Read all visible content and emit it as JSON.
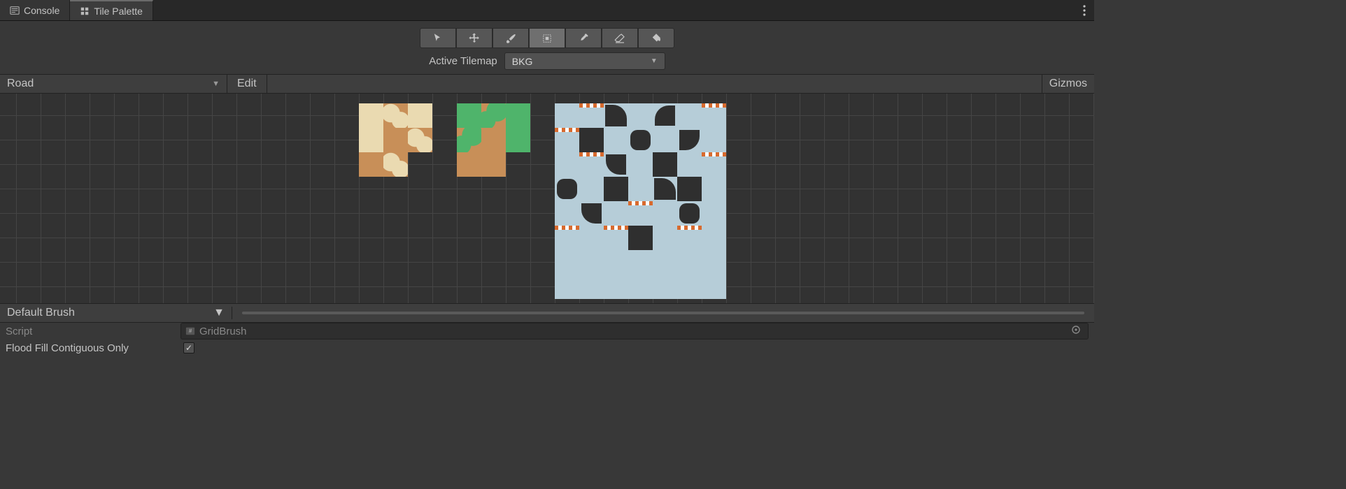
{
  "tabs": {
    "console": "Console",
    "tilepalette": "Tile Palette"
  },
  "tools": {
    "select": "select",
    "move": "move",
    "brush": "brush",
    "box": "box",
    "picker": "picker",
    "erase": "erase",
    "fill": "fill"
  },
  "active_tilemap_label": "Active Tilemap",
  "active_tilemap_value": "BKG",
  "palette": {
    "selected": "Road",
    "edit": "Edit",
    "gizmos": "Gizmos"
  },
  "brush": {
    "selected": "Default Brush"
  },
  "inspector": {
    "script_label": "Script",
    "script_value": "GridBrush",
    "flood_label": "Flood Fill Contiguous Only",
    "flood_checked": true
  }
}
